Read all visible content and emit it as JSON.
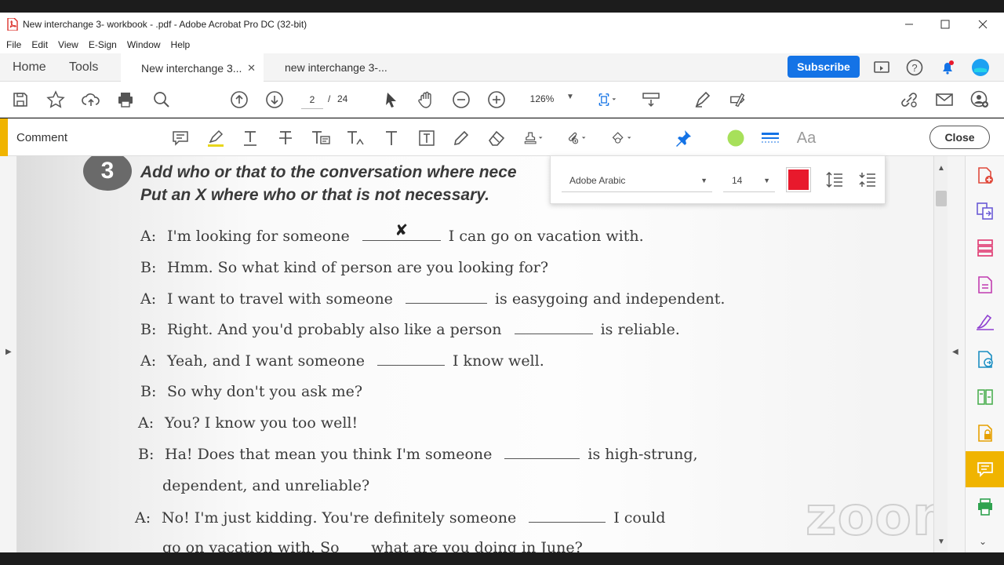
{
  "app": {
    "window_title": "New interchange 3- workbook - .pdf - Adobe Acrobat Pro DC (32-bit)"
  },
  "menu": [
    "File",
    "Edit",
    "View",
    "E-Sign",
    "Window",
    "Help"
  ],
  "tabs": {
    "home": "Home",
    "tools": "Tools",
    "doc_tabs": [
      {
        "label": "New interchange 3...",
        "active": true
      },
      {
        "label": "new interchange 3-...",
        "active": false
      }
    ],
    "subscribe": "Subscribe"
  },
  "toolbar": {
    "page_current": "2",
    "page_sep": "/",
    "page_total": "24",
    "zoom": "126%"
  },
  "comment_bar": {
    "label": "Comment",
    "close": "Close",
    "text_tool_label": "Aa"
  },
  "text_props": {
    "font": "Adobe Arabic",
    "size": "14",
    "color": "#e8192c"
  },
  "document": {
    "exercise_number": "3",
    "instruction_1": "Add who or that to the conversation where nece",
    "instruction_2": "Put an X where who or that is not necessary.",
    "lines": [
      {
        "speaker": "A:",
        "before": "I'm looking for someone",
        "blank_mark": "✘",
        "after": "I can go on vacation with."
      },
      {
        "speaker": "B:",
        "before": "Hmm. So what kind of person are you looking for?",
        "blank_mark": null,
        "after": ""
      },
      {
        "speaker": "A:",
        "before": "I want to travel with someone",
        "blank_mark": "",
        "after": "is easygoing and independent."
      },
      {
        "speaker": "B:",
        "before": "Right. And you'd probably also like a person",
        "blank_mark": "",
        "after": "is reliable."
      },
      {
        "speaker": "A:",
        "before": "Yeah, and I want someone",
        "blank_mark": "",
        "after": "I know well."
      },
      {
        "speaker": "B:",
        "before": "So why don't you ask me?",
        "blank_mark": null,
        "after": ""
      },
      {
        "speaker": "A:",
        "before": "You? I know you too well!",
        "blank_mark": null,
        "after": ""
      },
      {
        "speaker": "B:",
        "before": "Ha! Does that mean you think I'm someone",
        "blank_mark": "",
        "after": "is high-strung,"
      },
      {
        "speaker": "",
        "before": "dependent, and unreliable?",
        "blank_mark": null,
        "after": ""
      },
      {
        "speaker": "A:",
        "before": "No! I'm just kidding. You're definitely someone",
        "blank_mark": "",
        "after": "I could"
      },
      {
        "speaker": "",
        "before": "go on vacation with. So ___ what are you doing in June?",
        "blank_mark": null,
        "after": ""
      }
    ]
  },
  "overlay": {
    "watermark": "zoom"
  },
  "colors": {
    "accent": "#f0b400",
    "subscribe": "#1473e6",
    "pin": "#1473e6",
    "green_dot": "#a7e05a"
  }
}
